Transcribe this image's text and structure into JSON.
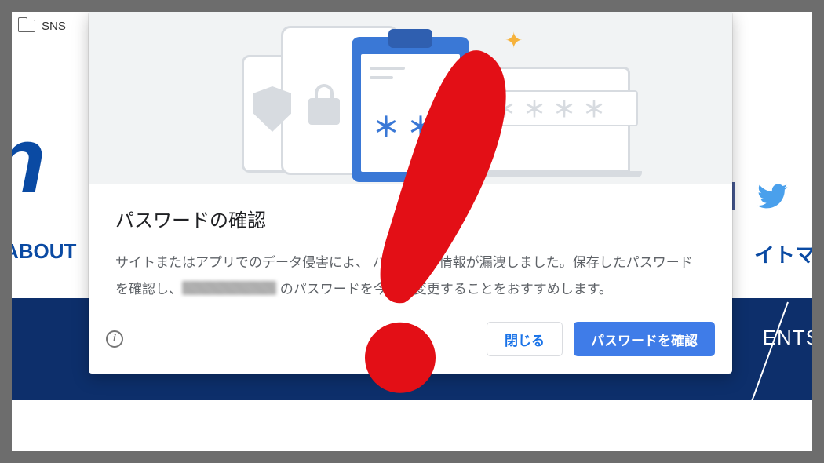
{
  "bookmark": {
    "folder_label": "SNS"
  },
  "page": {
    "logo_fragment": "n",
    "nav_left": "ABOUT",
    "nav_right": "イトマッ",
    "blueband_right": "ENTS"
  },
  "dialog": {
    "title": "パスワードの確認",
    "body_part1": "サイトまたはアプリでのデータ侵害によ",
    "body_part2": "、 パスワード情報が漏洩しました。保存したパスワードを確認し、",
    "body_part3": " のパスワードを今すぐ変更することをおすすめします。",
    "close_label": "閉じる",
    "confirm_label": "パスワードを確認",
    "asterisks": "＊＊",
    "pwbox": "＊＊＊＊"
  },
  "icons": {
    "info": "i"
  }
}
